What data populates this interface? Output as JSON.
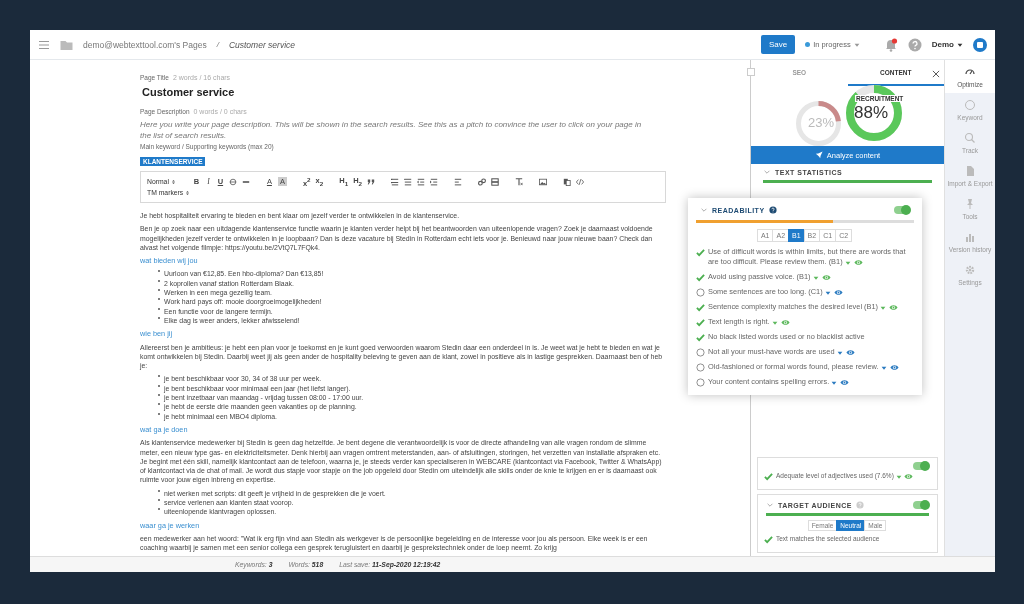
{
  "topbar": {
    "breadcrumb": "demo@webtexttool.com's Pages",
    "separator": "/",
    "page": "Customer service",
    "save": "Save",
    "status": "In progress",
    "user": "Demo"
  },
  "page": {
    "title_label": "Page Title",
    "title_stats": "2 words / 16 chars",
    "title": "Customer service",
    "description_label": "Page Description",
    "description_stats": "0 words / 0 chars",
    "description_placeholder": "Here you write your page description. This will be shown in the search results. See this as a pitch to convince the user to click on your page in the list of search results.",
    "keywords_label": "Main keyword / Supporting keywords (max 20)",
    "keywords": [
      "KLANTENSERVICE"
    ]
  },
  "toolbar": {
    "format": "Normal",
    "text_buttons": [
      "B",
      "I",
      "U",
      "A",
      "A",
      "x$^{2}$",
      "x$_{2}$",
      "H$_{1}$",
      "H$_{2}$"
    ],
    "markers": "TM markers"
  },
  "content": [
    {
      "kind": "paragraph",
      "text": "Je hebt hospitaliteit ervaring te bieden en bent klaar om jezelf verder te ontwikkelen in de klantenservice."
    },
    {
      "kind": "paragraph",
      "text": "Ben je op zoek naar een uitdagende klantenservice functie waarin je klanten verder helpt bij het beantwoorden van uiteenlopende vragen? Zoek je daarnaast voldoende mogelijkheden jezelf verder te ontwikkelen in je loopbaan? Dan is deze vacature bij Stedin in Rotterdam echt iets voor je. Benieuwd naar jouw nieuwe baan? Check dan alvast het volgende filmpje: https://youtu.be/2VtQ7L7FQk4."
    },
    {
      "kind": "heading",
      "text": "wat bieden wij jou"
    },
    {
      "kind": "list",
      "items": [
        "Uurloon van €12,85. Een hbo-diploma? Dan €13,85!",
        "2 koprollen vanaf station Rotterdam Blaak.",
        "Werken in een mega gezellig team.",
        "Work hard pays off: mooie doorgroeimogelijkheden!",
        "Een functie voor de langere termijn.",
        "Elke dag is weer anders, lekker afwisselend!"
      ]
    },
    {
      "kind": "heading",
      "text": "wie ben jij"
    },
    {
      "kind": "paragraph",
      "text": "Allereerst ben je ambitieus: je hebt een plan voor je toekomst en je kunt goed verwoorden waarom Stedin daar een onderdeel in is. Je weet wat je hebt te bieden en wat je komt ontwikkelen bij Stedin. Daarbij weet jij als geen ander de hospitality beleving te geven aan de klant, zowel in positieve als in lastige gesprekken. Daarnaast ben of heb je:"
    },
    {
      "kind": "list",
      "items": [
        "je bent beschikbaar voor 30, 34 of 38 uur per week.",
        "je bent beschikbaar voor minimaal een jaar (het liefst langer).",
        "je bent inzetbaar van maandag - vrijdag tussen 08:00 - 17:00 uur.",
        "je hebt de eerste drie maanden geen vakanties op de planning.",
        "je hebt minimaal een MBO4 diploma."
      ]
    },
    {
      "kind": "heading",
      "text": "wat ga je doen"
    },
    {
      "kind": "paragraph",
      "text": "Als klantenservice medewerker bij Stedin is geen dag hetzelfde. Je bent degene die verantwoordelijk is voor de directe afhandeling van alle vragen rondom de slimme meter, een nieuw type gas- en elektriciteitsmeter. Denk hierbij aan vragen omtrent meterstanden, aan- of afsluitingen, storingen, het verzetten van installatie afspraken etc. Je begint met één skill, namelijk klantcontact aan de telefoon, waarna je, je steeds verder kan specialiseren in WEBCARE (klantcontact via Facebook, Twitter & WhatsApp) of klantcontact via de chat of mail. Je wordt dus stapje voor stapje on the job opgeleid door Stedin om uiteindelijk alle skills onder de knie te krijgen en er is daarnaast ook ruimte voor jouw eigen inbreng en expertise."
    },
    {
      "kind": "list",
      "items": [
        "niet werken met scripts: dit geeft je vrijheid in de gesprekken die je voert.",
        "service verlenen aan klanten staat voorop.",
        "uiteenlopende klantvragen oplossen."
      ]
    },
    {
      "kind": "heading",
      "text": "waar ga je werken"
    },
    {
      "kind": "paragraph",
      "text": "een medewerker aan het woord: \"Wat ik erg fijn vind aan Stedin als werkgever is de persoonlijke begeleiding en de interesse voor jou als persoon. Elke week is er een coaching waarbij je samen met een senior collega een gesprek terugluistert en daarbij je gesprekstechniek onder de loep neemt. Zo krijg"
    }
  ],
  "status_bar": [
    "Keywords: **3**",
    "Words: **518**",
    "Last save: **11-Sep-2020 12:19:42**"
  ],
  "panel": {
    "tabs": [
      {
        "label": "SEO",
        "selected": false
      },
      {
        "label": "CONTENT",
        "selected": true
      }
    ],
    "scores": [
      {
        "reading": "23%",
        "level": 0.23
      },
      {
        "reading": "88%",
        "level": 0.88,
        "label": "RECRUITMENT"
      }
    ],
    "analyze": "Analyze content",
    "text_statistics": {
      "title": "TEXT STATISTICS",
      "level": 1
    },
    "adjectives": {
      "enabled": true,
      "checks": [
        {
          "text": "Adequate level of adjectives used (7.6%)",
          "passed": true,
          "details": true
        }
      ]
    },
    "target_audience": {
      "title": "TARGET AUDIENCE",
      "enabled": true,
      "level": 1,
      "options": [
        {
          "label": "Female",
          "selected": false
        },
        {
          "label": "Neutral",
          "selected": true
        },
        {
          "label": "Male",
          "selected": false
        }
      ],
      "checks": [
        {
          "text": "Text matches the selected audience",
          "passed": true,
          "details": false
        }
      ]
    }
  },
  "readability": {
    "title": "READABILITY",
    "enabled": true,
    "level": 0.63,
    "levels": [
      {
        "label": "A1",
        "selected": false
      },
      {
        "label": "A2",
        "selected": false
      },
      {
        "label": "B1",
        "selected": true
      },
      {
        "label": "B2",
        "selected": false
      },
      {
        "label": "C1",
        "selected": false
      },
      {
        "label": "C2",
        "selected": false
      }
    ],
    "checks": [
      {
        "text": "Use of difficult words is within limits, but there are words that are too difficult. Please review them. (B1)",
        "passed": true,
        "details": true
      },
      {
        "text": "Avoid using passive voice. (B1)",
        "passed": true,
        "details": true
      },
      {
        "text": "Some sentences are too long. (C1)",
        "passed": false,
        "details": true
      },
      {
        "text": "Sentence complexity matches the desired level (B1)",
        "passed": true,
        "details": true
      },
      {
        "text": "Text length is right.",
        "passed": true,
        "details": true
      },
      {
        "text": "No black listed words used or no blacklist active",
        "passed": true,
        "details": false
      },
      {
        "text": "Not all your must-have words are used",
        "passed": false,
        "details": true
      },
      {
        "text": "Old-fashioned or formal words found, please review.",
        "passed": false,
        "details": true
      },
      {
        "text": "Your content contains spelling errors.",
        "passed": false,
        "details": true
      }
    ]
  },
  "sidebar": [
    {
      "label": "Optimize",
      "selected": true
    },
    {
      "label": "Keyword",
      "selected": false
    },
    {
      "label": "Track",
      "selected": false
    },
    {
      "label": "Import & Export",
      "selected": false
    },
    {
      "label": "Tools",
      "selected": false
    },
    {
      "label": "Version history",
      "selected": false
    },
    {
      "label": "Settings",
      "selected": false
    }
  ]
}
